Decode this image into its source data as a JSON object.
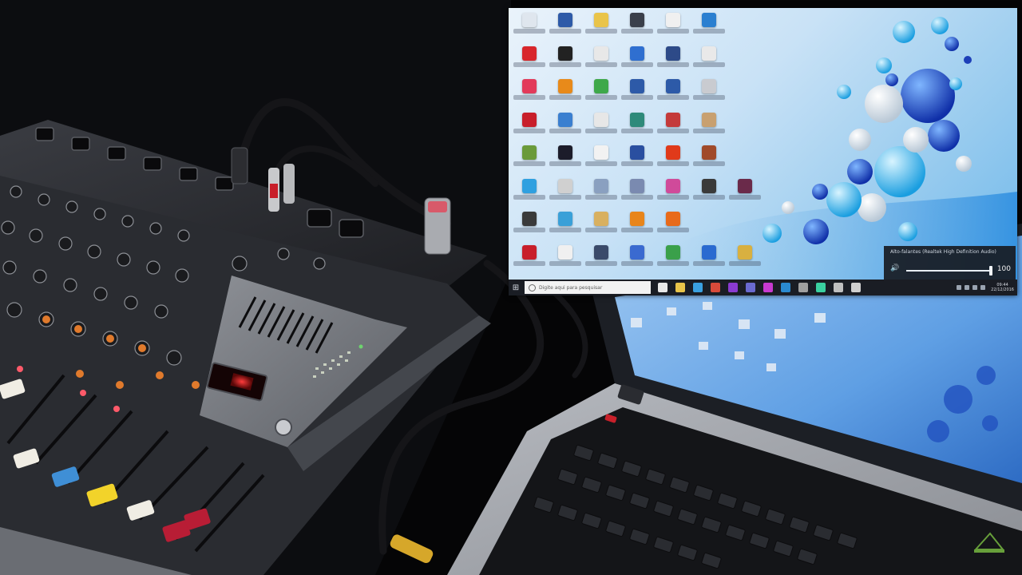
{
  "scene": {
    "description_tag": "photo",
    "mixer": {
      "brand_color": "#c9cbcf",
      "fader_cap_colors": [
        "#f0ede4",
        "#f0ede4",
        "#3f8fd6",
        "#f2d32a",
        "#f0ede4",
        "#b81d35",
        "#b81d35"
      ],
      "knob_accent_color": "#e07a2c"
    },
    "laptop": {
      "screen_color": "#6aa7e6"
    },
    "cable_plug_color": "#d6a72a"
  },
  "desktop": {
    "wallpaper_accent": "#1f6fd6",
    "icons": [
      {
        "color": "#dfe6ee"
      },
      {
        "color": "#2d5aa8"
      },
      {
        "color": "#e9c44a"
      },
      {
        "color": "#3a3f4a"
      },
      {
        "color": "#f0f0f0"
      },
      {
        "color": "#2a7fd0"
      },
      {
        "color": "#d8262b"
      },
      {
        "color": "#222222"
      },
      {
        "color": "#e8e8e8"
      },
      {
        "color": "#2f6fd0"
      },
      {
        "color": "#2d4a88"
      },
      {
        "color": "#e9e9e9"
      },
      {
        "color": "#e23a5a"
      },
      {
        "color": "#e88a1a"
      },
      {
        "color": "#3ea84a"
      },
      {
        "color": "#2d5aa8"
      },
      {
        "color": "#2d5aa8"
      },
      {
        "color": "#c9cbd0"
      },
      {
        "color": "#c81e2a"
      },
      {
        "color": "#3a7fd0"
      },
      {
        "color": "#e7e7e7"
      },
      {
        "color": "#2e8a7a"
      },
      {
        "color": "#c43a3a"
      },
      {
        "color": "#c8a070"
      },
      {
        "color": "#6a9a3a"
      },
      {
        "color": "#1c1c2a"
      },
      {
        "color": "#f2f2f2"
      },
      {
        "color": "#2a4fa0"
      },
      {
        "color": "#e03a1a"
      },
      {
        "color": "#a04a2a"
      },
      {
        "color": "#2fa0e0"
      },
      {
        "color": "#d0d0d0"
      },
      {
        "color": "#8aa0c0"
      },
      {
        "color": "#7a8ab0"
      },
      {
        "color": "#d04a9a"
      },
      {
        "color": "#3a3a3a"
      },
      {
        "color": "#6a2a4a"
      },
      {
        "color": "#3a3a3a"
      },
      {
        "color": "#3aa0d8"
      },
      {
        "color": "#d8b060"
      },
      {
        "color": "#e8851a"
      },
      {
        "color": "#e86a1a"
      },
      {
        "color": "#c81e2a"
      },
      {
        "color": "#f0f0f0"
      },
      {
        "color": "#3a4a6a"
      },
      {
        "color": "#3a6ad0"
      },
      {
        "color": "#3aa04a"
      },
      {
        "color": "#2a6ad0"
      },
      {
        "color": "#d8b040"
      }
    ],
    "taskbar": {
      "search_placeholder": "Digite aqui para pesquisar",
      "task_icon_colors": [
        "#e8e8e8",
        "#e8c44a",
        "#3aa0e0",
        "#d84a3a",
        "#8a3ad0",
        "#6a6ad0",
        "#c83ad0",
        "#2a8ad0",
        "#a0a0a0",
        "#3ad0a0",
        "#c0c0c0",
        "#d0d0d0"
      ],
      "clock_time": "09:44",
      "clock_date": "22/12/2016"
    },
    "volume_flyout": {
      "device": "Alto-falantes (Realtek High Definition Audio)",
      "value": "100",
      "level": 1.0
    }
  }
}
